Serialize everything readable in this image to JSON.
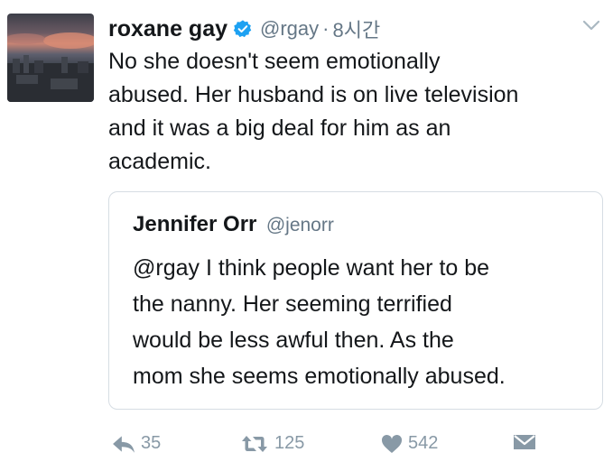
{
  "tweet": {
    "author_name": "roxane gay",
    "author_handle": "@rgay",
    "separator": "·",
    "time": "8시간",
    "text": "No she doesn't seem emotionally\nabused. Her husband is on live television\nand it was a big deal for him as an\nacademic."
  },
  "quoted_tweet": {
    "author_name": "Jennifer Orr",
    "author_handle": "@jenorr",
    "text": "@rgay I think people want her to be\nthe nanny. Her seeming terrified\nwould be less awful then. As the\nmom she seems emotionally abused."
  },
  "actions": {
    "reply_count": "35",
    "retweet_count": "125",
    "like_count": "542"
  },
  "icons": {
    "verified": "verified-badge-icon",
    "menu": "chevron-down-icon",
    "reply": "reply-icon",
    "retweet": "retweet-icon",
    "like": "heart-icon",
    "message": "envelope-icon"
  },
  "colors": {
    "verified_blue": "#1da1f2",
    "muted_gray": "#657786",
    "action_gray": "#8899a6",
    "text": "#14171a",
    "border": "#d6dde3"
  }
}
